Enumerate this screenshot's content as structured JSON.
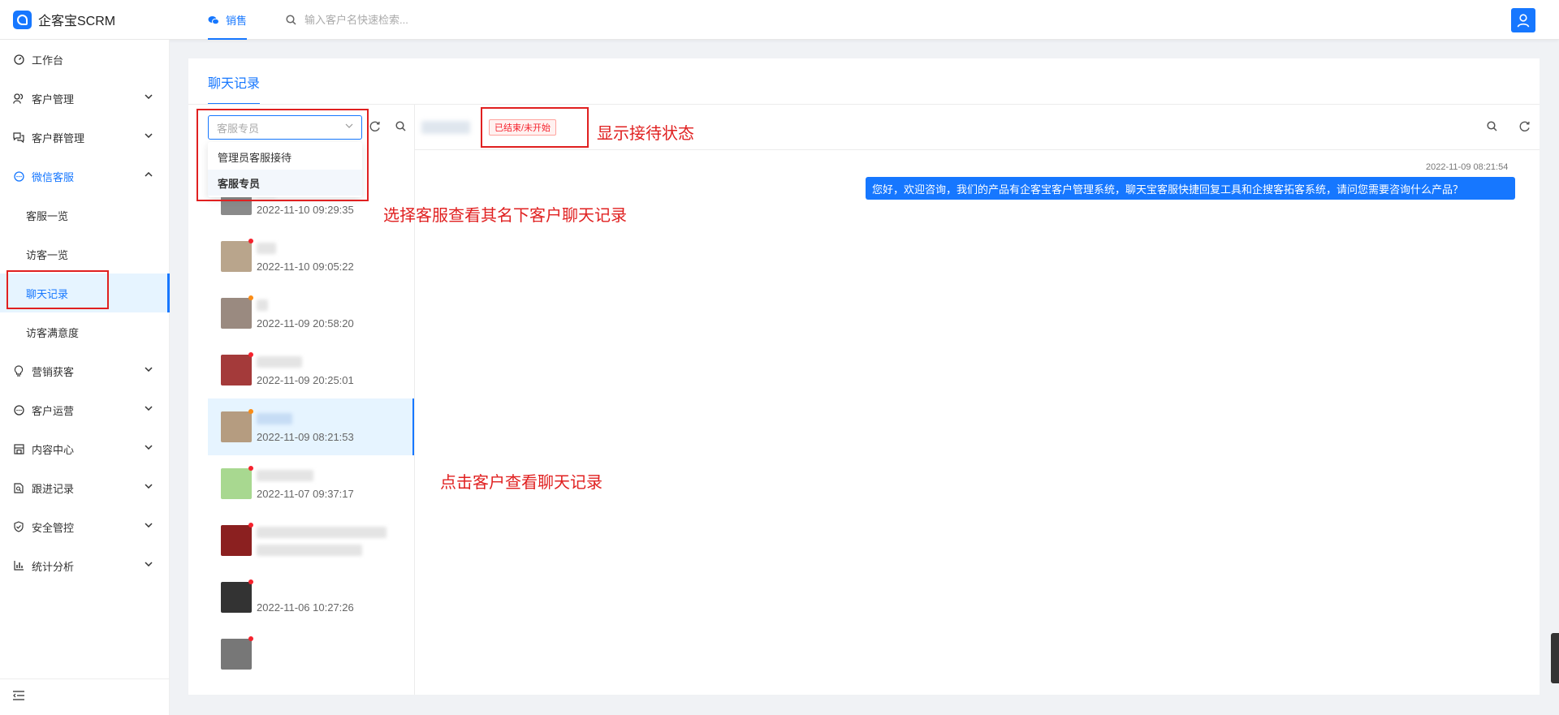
{
  "app": {
    "name": "企客宝SCRM"
  },
  "header": {
    "tab_label": "销售",
    "search_placeholder": "输入客户名快速检索..."
  },
  "sidebar": {
    "items": [
      {
        "label": "工作台"
      },
      {
        "label": "客户管理"
      },
      {
        "label": "客户群管理"
      },
      {
        "label": "微信客服"
      },
      {
        "label": "营销获客"
      },
      {
        "label": "客户运营"
      },
      {
        "label": "内容中心"
      },
      {
        "label": "跟进记录"
      },
      {
        "label": "安全管控"
      },
      {
        "label": "统计分析"
      }
    ],
    "subitems": [
      {
        "label": "客服一览"
      },
      {
        "label": "访客一览"
      },
      {
        "label": "聊天记录"
      },
      {
        "label": "访客满意度"
      }
    ]
  },
  "page": {
    "tab_label": "聊天记录"
  },
  "agent_select": {
    "placeholder": "客服专员",
    "options": [
      {
        "label": "管理员客服接待"
      },
      {
        "label": "客服专员"
      }
    ]
  },
  "contacts": [
    {
      "time": "2022-11-10 09:29:35",
      "status_color": "#52c41a",
      "avatar_color": "#8a8a8a"
    },
    {
      "time": "2022-11-10 09:05:22",
      "status_color": "#f5222d",
      "avatar_color": "#b9a58c"
    },
    {
      "time": "2022-11-09 20:58:20",
      "status_color": "#fa8c16",
      "avatar_color": "#9a8a80"
    },
    {
      "time": "2022-11-09 20:25:01",
      "status_color": "#f5222d",
      "avatar_color": "#a43a3a"
    },
    {
      "time": "2022-11-09 08:21:53",
      "status_color": "#fa8c16",
      "avatar_color": "#b59c80"
    },
    {
      "time": "2022-11-07 09:37:17",
      "status_color": "#f5222d",
      "avatar_color": "#a8d890"
    },
    {
      "time": "",
      "status_color": "#f5222d",
      "avatar_color": "#8b2020"
    },
    {
      "time": "2022-11-06 10:27:26",
      "status_color": "#f5222d",
      "avatar_color": "#333333"
    }
  ],
  "chat": {
    "status_tag": "已结束/未开始",
    "message_time": "2022-11-09 08:21:54",
    "message_text": "您好，欢迎咨询，我们的产品有企客宝客户管理系统，聊天宝客服快捷回复工具和企搜客拓客系统，请问您需要咨询什么产品？"
  },
  "annotations": {
    "status": "显示接待状态",
    "select_agent": "选择客服查看其名下客户聊天记录",
    "click_customer": "点击客户查看聊天记录"
  },
  "colors": {
    "primary": "#1677ff",
    "annotation": "#e02020"
  }
}
